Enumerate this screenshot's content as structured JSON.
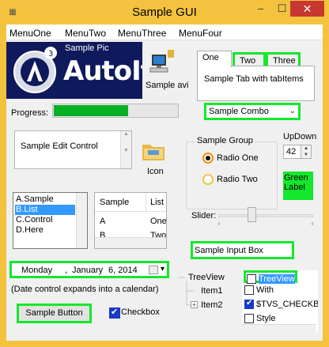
{
  "window": {
    "title": "Sample GUI",
    "app_icon": "autoit-icon",
    "controls": {
      "minimize": "–",
      "maximize": "☐",
      "close": "✕"
    },
    "accent_color": "#f3c33f"
  },
  "menu": [
    "MenuOne",
    "MenuTwo",
    "MenuThree",
    "MenuFour"
  ],
  "logo": {
    "subtitle": "Sample Pic",
    "text": "AutoIt",
    "icon": "autoit-logo-icon",
    "bg": "#0f1a5c"
  },
  "avi": {
    "label": "Sample avi",
    "icon": "computer-animation-icon"
  },
  "tabs": {
    "items": [
      "One",
      "Two",
      "Three"
    ],
    "active": "One",
    "content": "Sample Tab with tabItems"
  },
  "progress": {
    "label": "Progress:",
    "value": 0.6,
    "color": "#06b025"
  },
  "combo": {
    "value": "Sample Combo"
  },
  "edit": {
    "text": "Sample Edit Control"
  },
  "icon_control": {
    "label": "Icon",
    "icon": "folder-icon"
  },
  "group": {
    "label": "Sample Group",
    "radios": [
      {
        "label": "Radio One",
        "checked": true
      },
      {
        "label": "Radio Two",
        "checked": false
      }
    ]
  },
  "updown": {
    "label": "UpDown",
    "value": "42"
  },
  "green_label": {
    "text": "Green Label",
    "color": "#13e82c"
  },
  "listbox": {
    "items": [
      "A.Sample",
      "B.List",
      "C.Control",
      "D.Here"
    ],
    "selected": "B.List"
  },
  "listview": {
    "columns": [
      "Sample",
      "List"
    ],
    "rows": [
      [
        "A",
        "One"
      ],
      [
        "B",
        "Two"
      ]
    ]
  },
  "slider": {
    "label": "Slider:",
    "value": 0.4
  },
  "inputbox": {
    "value": "Sample Input Box"
  },
  "date": {
    "day": "Monday",
    "comma": ",",
    "month": "January",
    "date": "6, 2014",
    "note": "(Date control expands into a calendar)"
  },
  "tree": {
    "root": "TreeView",
    "children": [
      "Item1",
      "Item2"
    ]
  },
  "checklist": {
    "items": [
      {
        "label": "TreeView",
        "checked": false,
        "selected": true
      },
      {
        "label": "With",
        "checked": false,
        "selected": false
      },
      {
        "label": "$TVS_CHECKBOXES",
        "checked": true,
        "selected": false
      },
      {
        "label": "Style",
        "checked": false,
        "selected": false
      }
    ]
  },
  "button": {
    "label": "Sample Button"
  },
  "checkbox": {
    "label": "Checkbox",
    "checked": true
  }
}
